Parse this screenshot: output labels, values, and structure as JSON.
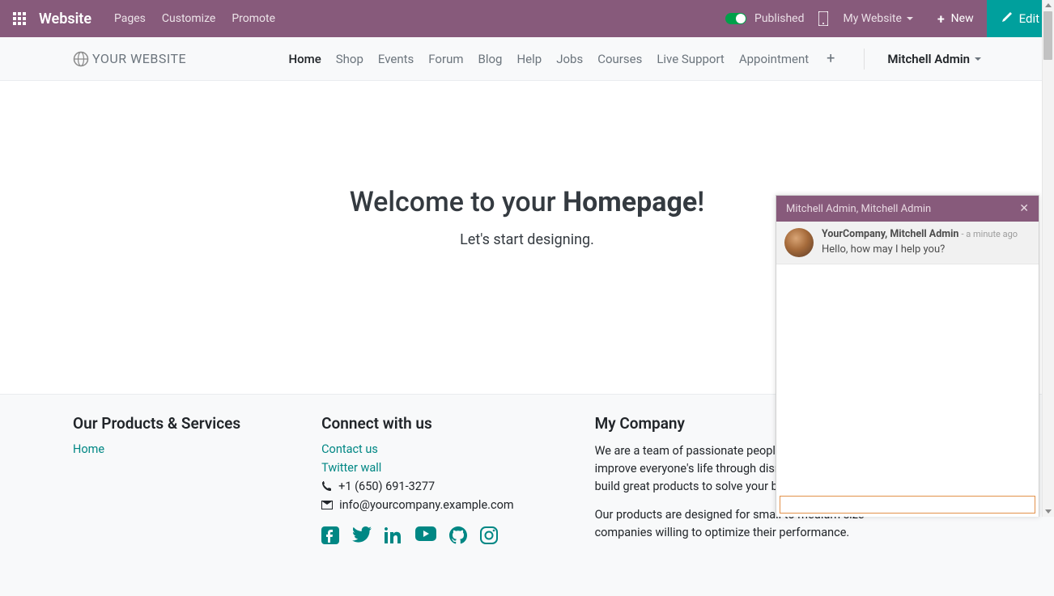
{
  "topbar": {
    "brand": "Website",
    "menu": [
      "Pages",
      "Customize",
      "Promote"
    ],
    "published_label": "Published",
    "my_website_label": "My Website",
    "new_label": "New",
    "edit_label": "Edit"
  },
  "navbar": {
    "logo_text": "YOUR WEBSITE",
    "links": [
      "Home",
      "Shop",
      "Events",
      "Forum",
      "Blog",
      "Help",
      "Jobs",
      "Courses",
      "Live Support",
      "Appointment"
    ],
    "active_index": 0,
    "user": "Mitchell Admin"
  },
  "hero": {
    "title_prefix": "Welcome to your ",
    "title_strong": "Homepage",
    "title_suffix": "!",
    "subtitle": "Let's start designing."
  },
  "footer": {
    "col1": {
      "heading": "Our Products & Services",
      "links": [
        "Home"
      ]
    },
    "col2": {
      "heading": "Connect with us",
      "links": [
        "Contact us",
        "Twitter wall"
      ],
      "phone": "+1 (650) 691-3277",
      "email": "info@yourcompany.example.com"
    },
    "col3": {
      "heading": "My Company",
      "about1": "We are a team of passionate people whose goal is to improve everyone's life through disruptive products. We build great products to solve your business problems.",
      "about2": "Our products are designed for small to medium size companies willing to optimize their performance."
    }
  },
  "chat": {
    "title": "Mitchell Admin, Mitchell Admin",
    "author": "YourCompany, Mitchell Admin",
    "timestamp": "a minute ago",
    "message": "Hello, how may I help you?",
    "placeholder": ""
  },
  "colors": {
    "accent_purple": "#875a7b",
    "accent_teal": "#00a09d",
    "link_teal": "#008784"
  }
}
